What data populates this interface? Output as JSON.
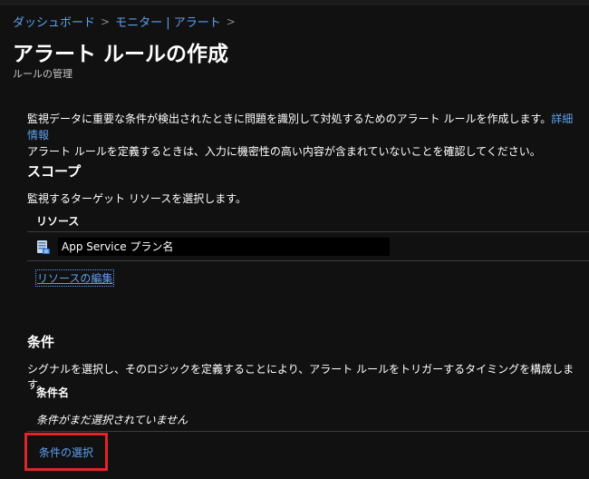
{
  "breadcrumb": {
    "items": [
      "ダッシュボード",
      "モニター | アラート"
    ],
    "separator": ">"
  },
  "page": {
    "title": "アラート ルールの作成",
    "subtitle": "ルールの管理"
  },
  "description": {
    "line1": "監視データに重要な条件が検出されたときに問題を識別して対処するためのアラート ルールを作成します。",
    "learn_more": "詳細情報",
    "line2": "アラート ルールを定義するときは、入力に機密性の高い内容が含まれていないことを確認してください。"
  },
  "scope": {
    "title": "スコープ",
    "description": "監視するターゲット リソースを選択します。",
    "column_header": "リソース",
    "resource_name": "App Service プラン名",
    "edit_link": "リソースの編集"
  },
  "condition": {
    "title": "条件",
    "description": "シグナルを選択し、そのロジックを定義することにより、アラート ルールをトリガーするタイミングを構成します。",
    "column_header": "条件名",
    "empty_text": "条件がまだ選択されていません",
    "select_link": "条件の選択"
  },
  "colors": {
    "background": "#111111",
    "link": "#5ea0ef",
    "highlight": "#e0242a"
  }
}
